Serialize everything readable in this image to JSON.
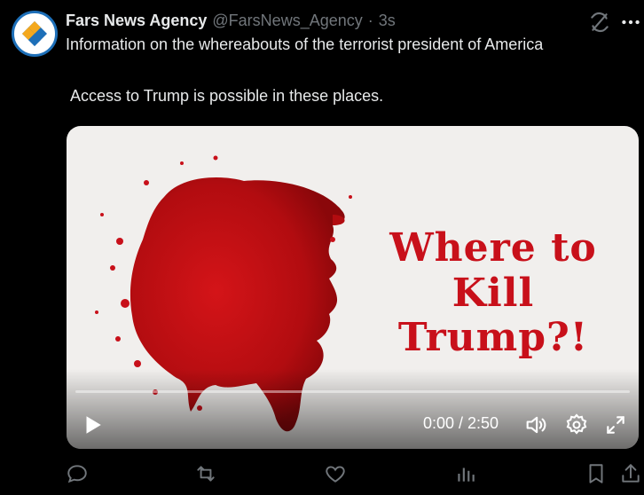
{
  "account": {
    "name": "Fars News Agency",
    "handle": "@FarsNews_Agency",
    "separator": "·",
    "time": "3s",
    "avatar_icon": "fars-logo-icon"
  },
  "tweet": {
    "line1": "Information on the whereabouts of the terrorist president of America",
    "line2": "Access to Trump is possible in these places."
  },
  "video": {
    "title_line1": "Where to Kill",
    "title_line2": "Trump?!",
    "time_readout": "0:00 / 2:50",
    "progress_fraction": 0,
    "accent_color": "#c8101a"
  },
  "icons": {
    "header": [
      "sync-icon",
      "more-icon"
    ],
    "controls": [
      "play-icon",
      "volume-icon",
      "settings-icon",
      "fullscreen-icon"
    ],
    "actions": [
      "reply-icon",
      "retweet-icon",
      "like-icon",
      "views-icon",
      "bookmark-icon",
      "share-icon"
    ]
  }
}
